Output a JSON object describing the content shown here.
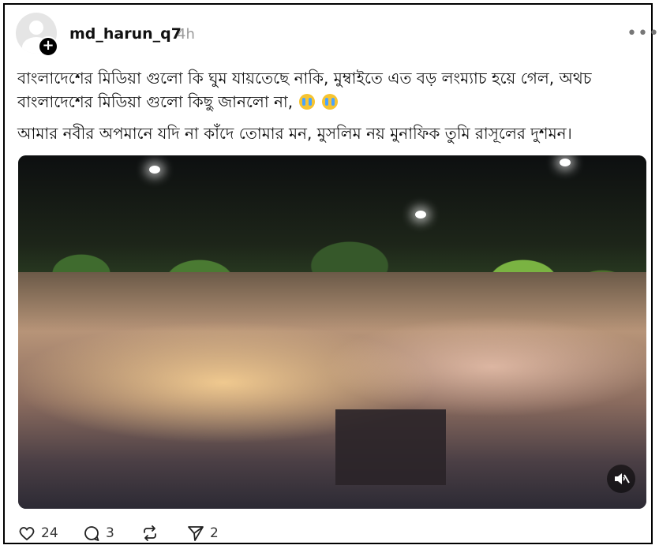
{
  "post": {
    "username": "md_harun_q7",
    "time": "4h",
    "text": {
      "line1": "বাংলাদেশের মিডিয়া গুলো কি ঘুম যায়তেছে নাকি, মুম্বাইতে এত বড় লংম্যাচ হয়ে গেল, অথচ বাংলাদেশের মিডিয়া গুলো কিছু জানলো না,",
      "line2": "আমার নবীর অপমানে যদি না কাঁদে তোমার মন, মুসলিম নয় মুনাফিক তুমি রাসূলের দুশমন।"
    },
    "emojis": [
      "crying-face-icon",
      "crying-face-icon"
    ],
    "actions": {
      "likes": "24",
      "replies": "3",
      "reposts": "",
      "shares": "2"
    }
  },
  "icons": {
    "avatar": "default-avatar-icon",
    "follow": "plus-icon",
    "more": "more-horizontal-icon",
    "like": "heart-icon",
    "reply": "comment-icon",
    "repost": "repost-icon",
    "share": "send-icon",
    "mute": "muted-speaker-icon"
  }
}
